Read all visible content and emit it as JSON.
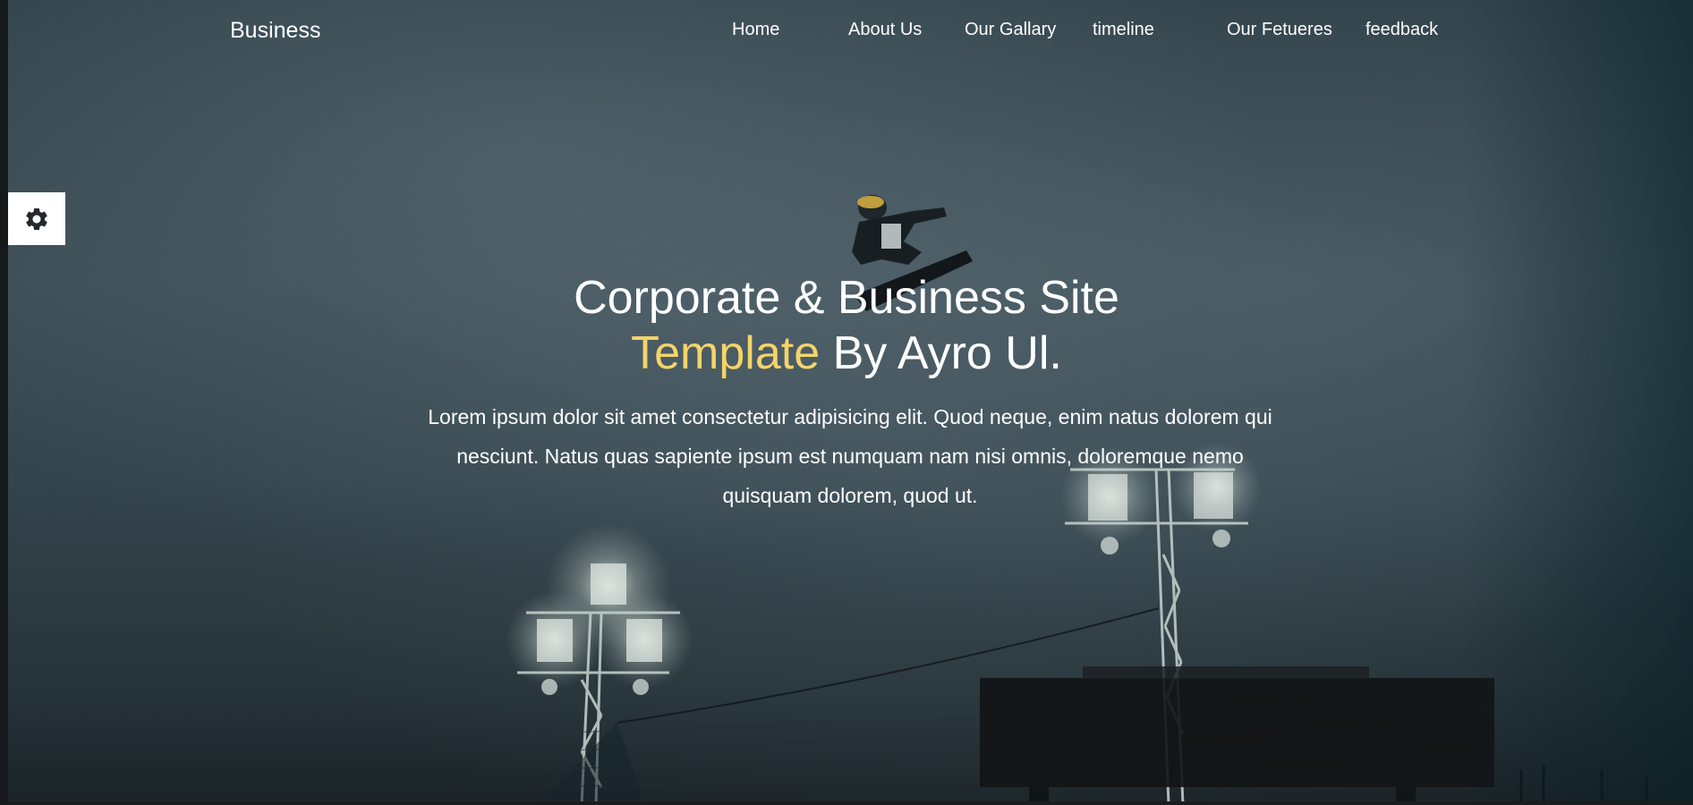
{
  "brand": "Business",
  "nav": {
    "items": [
      "Home",
      "About Us",
      "Our Gallary",
      "timeline",
      "Our Fetueres",
      "feedback"
    ]
  },
  "settings": {
    "icon": "gear-icon"
  },
  "hero": {
    "title_line1": "Corporate & Business Site",
    "title_accent": "Template",
    "title_rest": " By Ayro Ul.",
    "description": "Lorem ipsum dolor sit amet consectetur adipisicing elit. Quod neque, enim natus dolorem qui nesciunt. Natus quas sapiente ipsum est numquam nam nisi omnis, doloremque nemo quisquam dolorem, quod ut."
  },
  "colors": {
    "accent": "#f4d46a",
    "text": "#ffffff",
    "overlay": "#2f4048"
  }
}
